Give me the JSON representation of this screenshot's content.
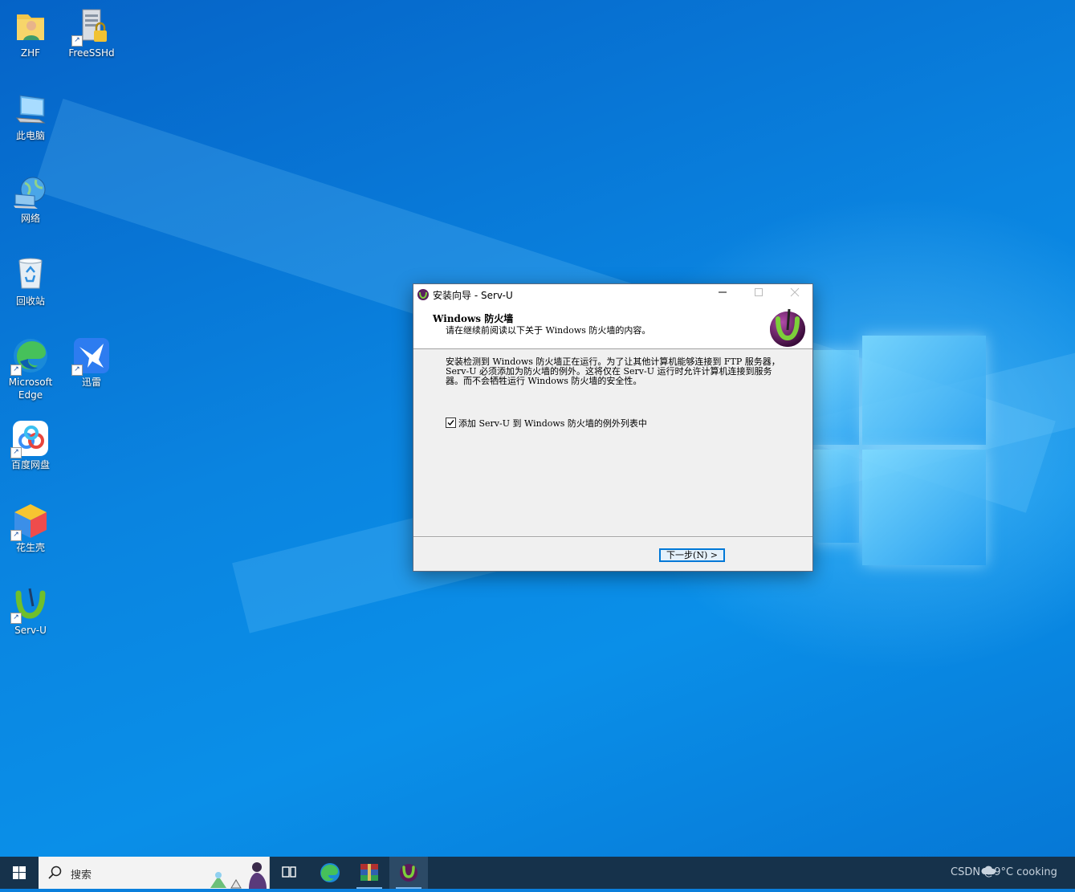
{
  "desktop": {
    "icons": [
      {
        "label": "ZHF"
      },
      {
        "label": "FreeSSHd"
      },
      {
        "label": "此电脑"
      },
      {
        "label": "网络"
      },
      {
        "label": "回收站"
      },
      {
        "label": "Microsoft Edge"
      },
      {
        "label": "迅雷"
      },
      {
        "label": "百度网盘"
      },
      {
        "label": "花生壳"
      },
      {
        "label": "Serv-U"
      }
    ]
  },
  "dialog": {
    "title": "安装向导 - Serv-U",
    "header_title": "Windows 防火墙",
    "header_subtitle": "请在继续前阅读以下关于 Windows 防火墙的内容。",
    "body_text": "安装检测到 Windows 防火墙正在运行。为了让其他计算机能够连接到 FTP 服务器，Serv-U 必须添加为防火墙的例外。这将仅在 Serv-U 运行时允许计算机连接到服务器。而不会牺牲运行 Windows 防火墙的安全性。",
    "checkbox_label": "添加 Serv-U 到 Windows 防火墙的例外列表中",
    "checkbox_checked": true,
    "next_button": "下一步(N) >"
  },
  "taskbar": {
    "search_placeholder": "搜索",
    "tray_text": "CSDN @9°C cooking"
  },
  "colors": {
    "accent": "#0078d7",
    "taskbar": "#16324b"
  }
}
